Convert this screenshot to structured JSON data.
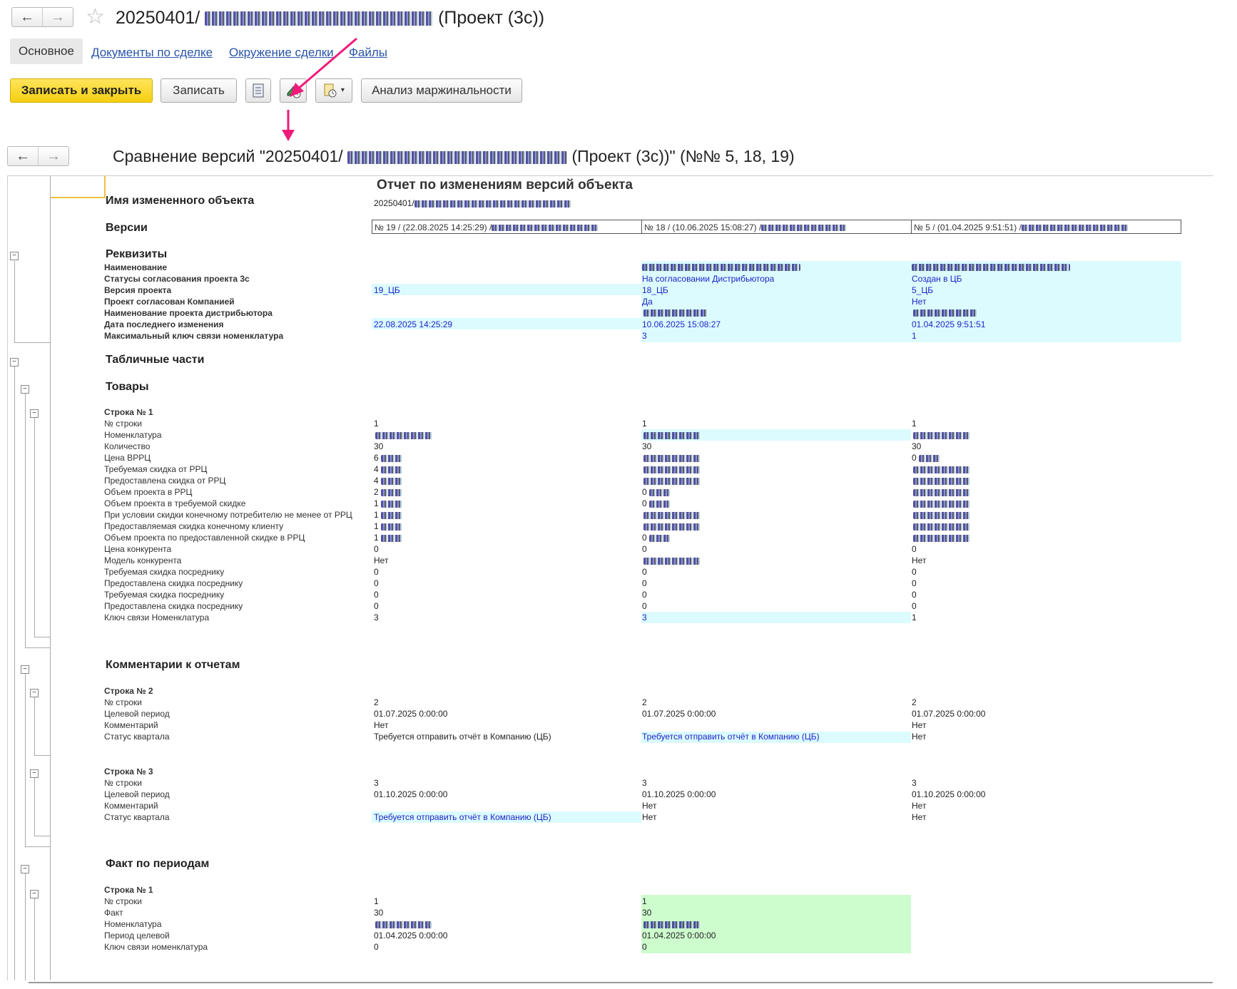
{
  "window": {
    "title_prefix": "20250401/",
    "title_suffix": "(Проект (3с))"
  },
  "tabs": [
    "Основное",
    "Документы по сделке",
    "Окружение сделки",
    "Файлы"
  ],
  "toolbar": {
    "save_close": "Записать и закрыть",
    "save": "Записать",
    "analysis": "Анализ маржинальности"
  },
  "compare": {
    "title_prefix": "Сравнение версий \"20250401/",
    "title_suffix": "(Проект (3с))\" (№№ 5, 18, 19)"
  },
  "report": {
    "title": "Отчет по изменениям версий объекта",
    "object_label": "Имя измененного объекта",
    "object_value": "20250401/",
    "versions_label": "Версии",
    "versions": [
      "№ 19 / (22.08.2025 14:25:29) /",
      "№ 18 / (10.06.2025 15:08:27) /",
      "№ 5 / (01.04.2025 9:51:51) /"
    ],
    "requisites": {
      "header": "Реквизиты",
      "rows": [
        {
          "label": "Наименование",
          "v": [
            "",
            "",
            ""
          ]
        },
        {
          "label": "Статусы согласования проекта 3с",
          "v": [
            "",
            "На согласовании Дистрибьютора",
            "Создан в ЦБ"
          ]
        },
        {
          "label": "Версия проекта",
          "v": [
            "19_ЦБ",
            "18_ЦБ",
            "5_ЦБ"
          ]
        },
        {
          "label": "Проект согласован Компанией",
          "v": [
            "",
            "Да",
            "Нет"
          ]
        },
        {
          "label": "Наименование проекта дистрибьютора",
          "v": [
            "",
            "",
            ""
          ]
        },
        {
          "label": "Дата последнего изменения",
          "v": [
            "22.08.2025 14:25:29",
            "10.06.2025 15:08:27",
            "01.04.2025 9:51:51"
          ]
        },
        {
          "label": "Максимальный ключ связи номенклатура",
          "v": [
            "",
            "3",
            "1"
          ]
        }
      ]
    },
    "tables_header": "Табличные части",
    "goods": {
      "header": "Товары",
      "row_title": "Строка № 1",
      "rows": [
        {
          "label": "№ строки",
          "v": [
            "1",
            "1",
            "1"
          ]
        },
        {
          "label": "Номенклатура",
          "v": [
            "",
            "",
            ""
          ]
        },
        {
          "label": "Количество",
          "v": [
            "30",
            "30",
            "30"
          ]
        },
        {
          "label": "Цена ВРРЦ",
          "v": [
            "6",
            "",
            "0"
          ]
        },
        {
          "label": "Требуемая скидка от РРЦ",
          "v": [
            "4",
            "",
            ""
          ]
        },
        {
          "label": "Предоставлена скидка от РРЦ",
          "v": [
            "4",
            "",
            ""
          ]
        },
        {
          "label": "Объем проекта в РРЦ",
          "v": [
            "2",
            "0",
            ""
          ]
        },
        {
          "label": "Объем проекта в требуемой скидке",
          "v": [
            "1",
            "0",
            ""
          ]
        },
        {
          "label": "При условии скидки конечному потребителю не менее от РРЦ",
          "v": [
            "1",
            "",
            ""
          ]
        },
        {
          "label": "Предоставляемая скидка конечному клиенту",
          "v": [
            "1",
            "",
            ""
          ]
        },
        {
          "label": "Объем проекта по предоставленной скидке в РРЦ",
          "v": [
            "1",
            "0",
            ""
          ]
        },
        {
          "label": "Цена конкурента",
          "v": [
            "0",
            "0",
            "0"
          ]
        },
        {
          "label": "Модель конкурента",
          "v": [
            "Нет",
            "",
            "Нет"
          ]
        },
        {
          "label": "Требуемая скидка посреднику",
          "v": [
            "0",
            "0",
            "0"
          ]
        },
        {
          "label": "Предоставлена скидка посреднику",
          "v": [
            "0",
            "0",
            "0"
          ]
        },
        {
          "label": "Требуемая скидка посреднику",
          "v": [
            "0",
            "0",
            "0"
          ]
        },
        {
          "label": "Предоставлена скидка посреднику",
          "v": [
            "0",
            "0",
            "0"
          ]
        },
        {
          "label": "Ключ связи Номенклатура",
          "v": [
            "3",
            "3",
            "1"
          ]
        }
      ]
    },
    "comments": {
      "header": "Комментарии к отчетам",
      "row2_title": "Строка № 2",
      "row2": [
        {
          "label": "№ строки",
          "v": [
            "2",
            "2",
            "2"
          ]
        },
        {
          "label": "Целевой период",
          "v": [
            "01.07.2025 0:00:00",
            "01.07.2025 0:00:00",
            "01.07.2025 0:00:00"
          ]
        },
        {
          "label": "Комментарий",
          "v": [
            "Нет",
            "",
            "Нет"
          ]
        },
        {
          "label": "Статус квартала",
          "v": [
            "Требуется отправить отчёт в Компанию (ЦБ)",
            "Требуется отправить отчёт в Компанию (ЦБ)",
            "Нет"
          ]
        }
      ],
      "row3_title": "Строка № 3",
      "row3": [
        {
          "label": "№ строки",
          "v": [
            "3",
            "3",
            "3"
          ]
        },
        {
          "label": "Целевой период",
          "v": [
            "01.10.2025 0:00:00",
            "01.10.2025 0:00:00",
            "01.10.2025 0:00:00"
          ]
        },
        {
          "label": "Комментарий",
          "v": [
            "",
            "Нет",
            "Нет"
          ]
        },
        {
          "label": "Статус квартала",
          "v": [
            "Требуется отправить отчёт в Компанию (ЦБ)",
            "Нет",
            "Нет"
          ]
        }
      ]
    },
    "facts": {
      "header": "Факт по периодам",
      "row_title": "Строка № 1",
      "rows": [
        {
          "label": "№ строки",
          "v": [
            "1",
            "1"
          ]
        },
        {
          "label": "Факт",
          "v": [
            "30",
            "30"
          ]
        },
        {
          "label": "Номенклатура",
          "v": [
            "",
            ""
          ]
        },
        {
          "label": "Период целевой",
          "v": [
            "01.04.2025 0:00:00",
            "01.04.2025 0:00:00"
          ]
        },
        {
          "label": "Ключ связи номенклатура",
          "v": [
            "0",
            "0"
          ]
        }
      ]
    }
  }
}
